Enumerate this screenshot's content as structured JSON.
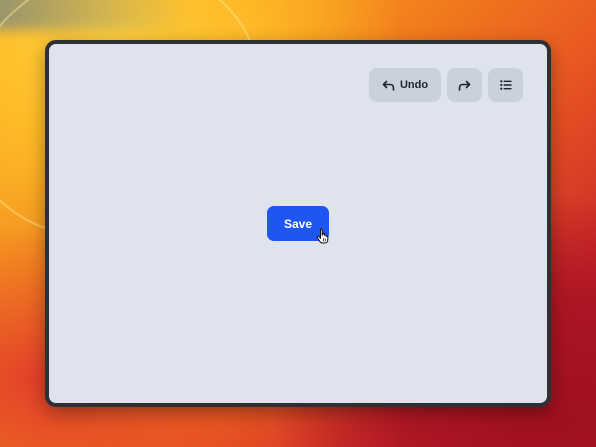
{
  "toolbar": {
    "undo_label": "Undo",
    "undo_icon": "undo-arrow-icon",
    "redo_icon": "redo-arrow-icon",
    "list_icon": "list-icon"
  },
  "main": {
    "save_label": "Save"
  },
  "colors": {
    "window_bg": "#dfe3ee",
    "toolbar_button_bg": "#c9d1dd",
    "save_button_bg": "#1f55f0"
  }
}
